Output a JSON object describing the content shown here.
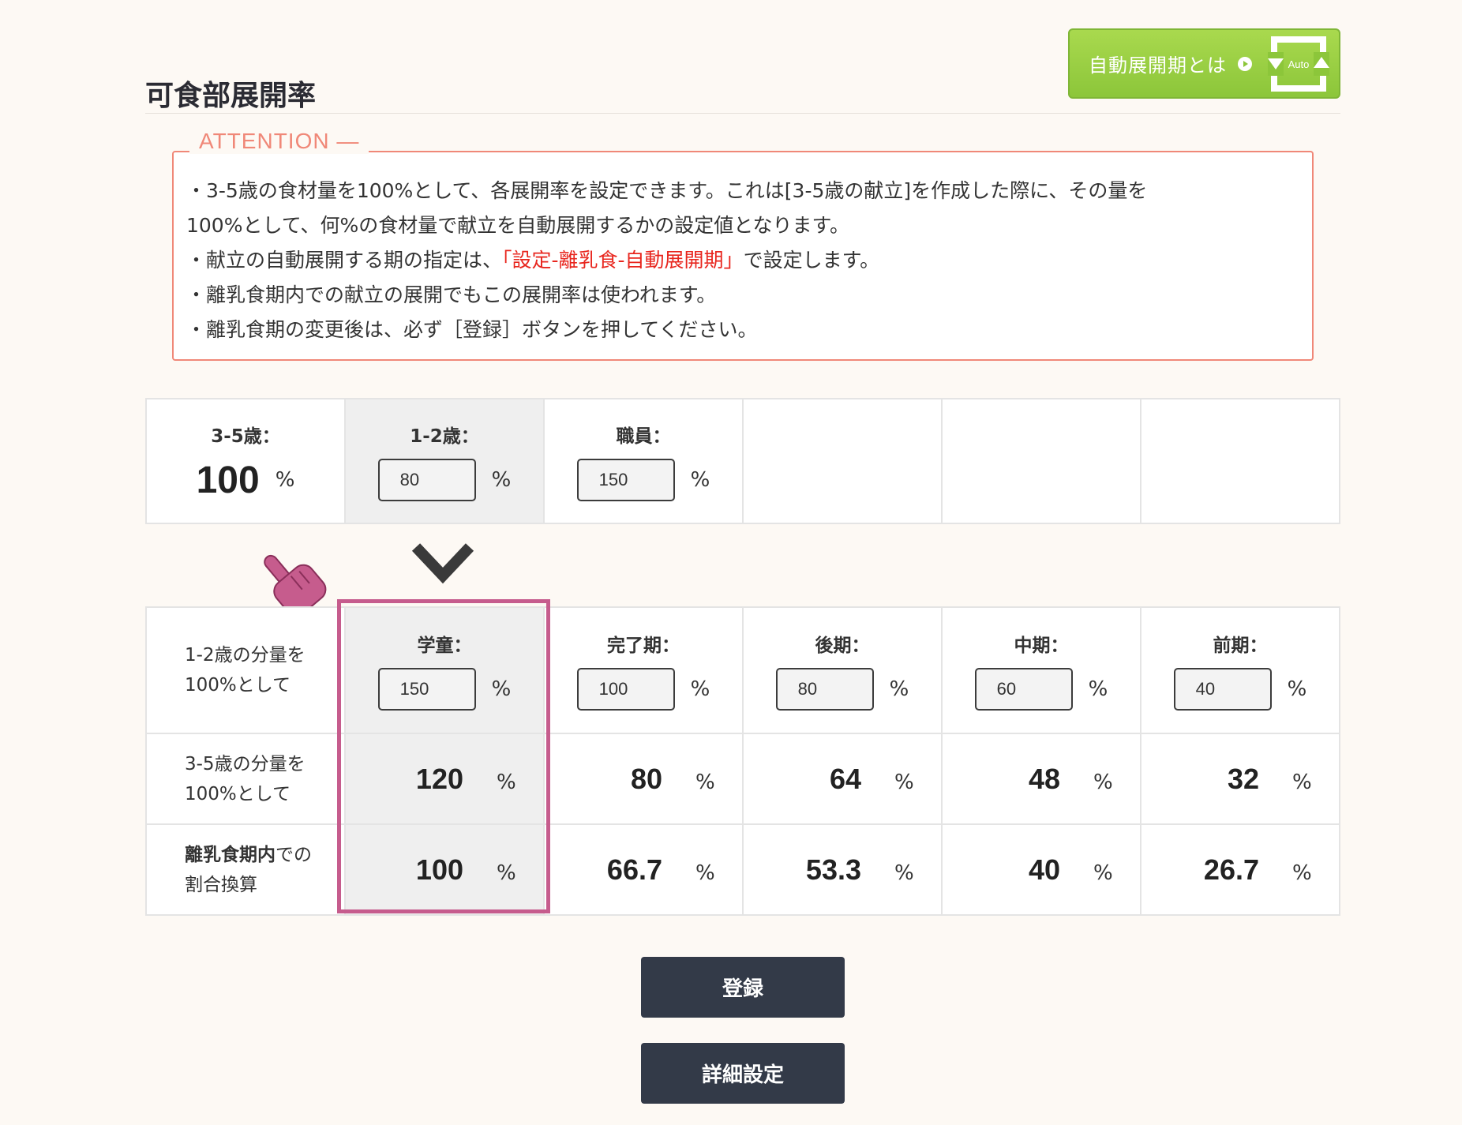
{
  "page": {
    "title": "可食部展開率"
  },
  "auto_button": {
    "label": "自動展開期とは",
    "icon_text": "Auto"
  },
  "attention": {
    "legend": "ATTENTION —",
    "line1": "・3-5歳の食材量を100%として、各展開率を設定できます。これは[3-5歳の献立]を作成した際に、その量を",
    "line2": "100%として、何%の食材量で献立を自動展開するかの設定値となります。",
    "line3_prefix": "・献立の自動展開する期の指定は、",
    "line3_link": "「設定-離乳食-自動展開期」",
    "line3_suffix": "で設定します。",
    "line4": "・離乳食期内での献立の展開でもこの展開率は使われます。",
    "line5": "・離乳食期の変更後は、必ず［登録］ボタンを押してください。"
  },
  "top_row": {
    "age35": {
      "label": "3-5歳：",
      "value": "100",
      "unit": "%"
    },
    "age12": {
      "label": "1-2歳：",
      "value": "80",
      "unit": "%"
    },
    "staff": {
      "label": "職員：",
      "value": "150",
      "unit": "%"
    }
  },
  "bottom": {
    "row_labels": {
      "r1_line1": "1-2歳の分量を",
      "r1_line2": "100%として",
      "r2_line1": "3-5歳の分量を",
      "r2_line2": "100%として",
      "r3_line1_bold": "離乳食期内",
      "r3_line1_rest": "での",
      "r3_line2": "割合換算"
    },
    "columns": [
      {
        "label": "学童：",
        "input": "150",
        "unit": "%",
        "r2": "120",
        "r3": "100"
      },
      {
        "label": "完了期：",
        "input": "100",
        "unit": "%",
        "r2": "80",
        "r3": "66.7"
      },
      {
        "label": "後期：",
        "input": "80",
        "unit": "%",
        "r2": "64",
        "r3": "53.3"
      },
      {
        "label": "中期：",
        "input": "60",
        "unit": "%",
        "r2": "48",
        "r3": "40"
      },
      {
        "label": "前期：",
        "input": "40",
        "unit": "%",
        "r2": "32",
        "r3": "26.7"
      }
    ],
    "unit": "%"
  },
  "buttons": {
    "register": "登録",
    "detail": "詳細設定"
  },
  "colors": {
    "accent_red": "#e8261e",
    "attention": "#f08878",
    "highlight": "#c65c8d",
    "dark_button": "#333a48",
    "auto_green": "#8cc63a"
  }
}
